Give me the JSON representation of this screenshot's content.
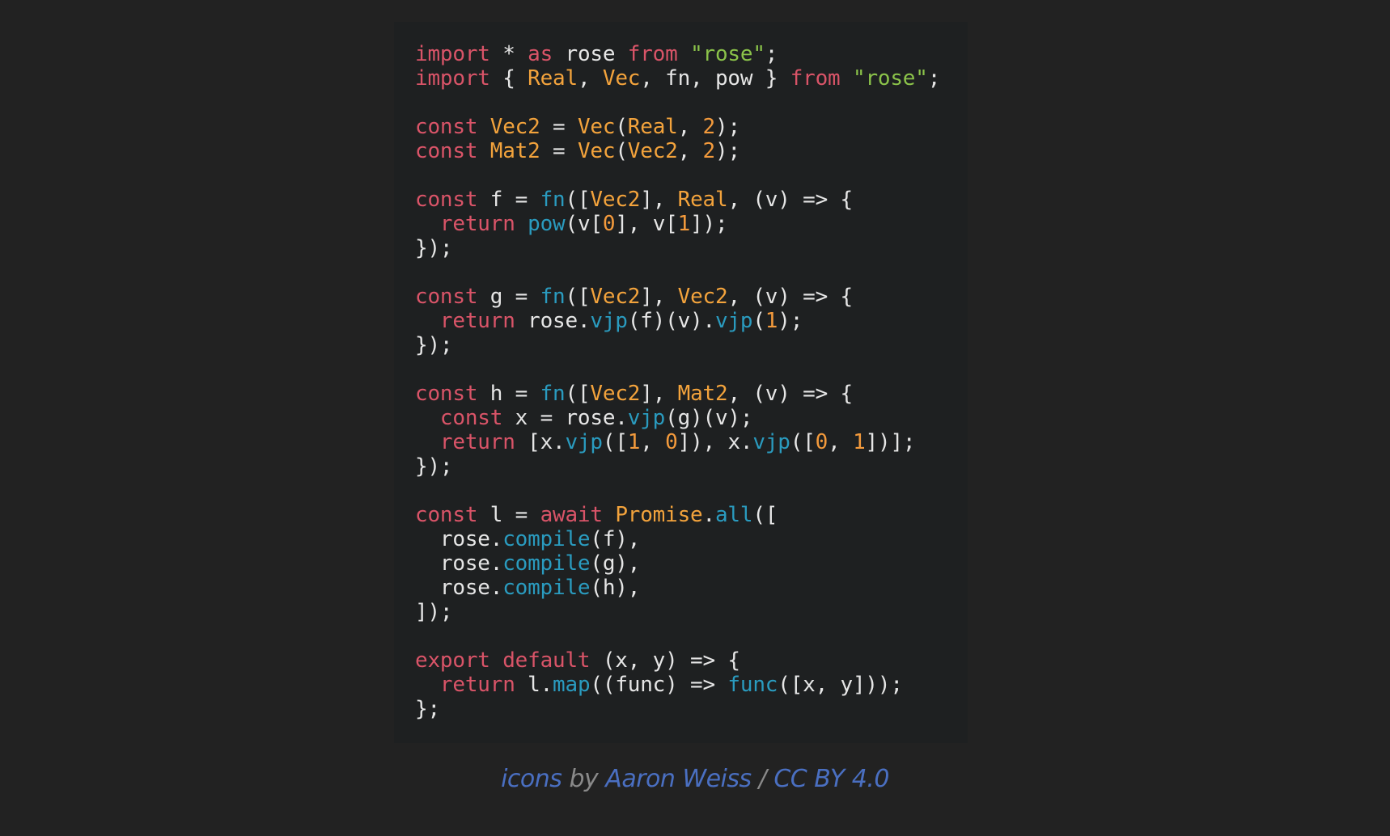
{
  "colors": {
    "background": "#222222",
    "code_background": "#1e2021",
    "keyword": "#d95468",
    "string": "#8bc34a",
    "type": "#f3a33c",
    "function": "#2a9bbf",
    "number": "#f39a3c",
    "plain": "#e6e6e6",
    "link": "#4a6fc1",
    "muted": "#8a8a8a"
  },
  "code": {
    "lines": [
      [
        [
          "kw",
          "import"
        ],
        [
          "pl",
          " * "
        ],
        [
          "kw",
          "as"
        ],
        [
          "pl",
          " rose "
        ],
        [
          "kw",
          "from"
        ],
        [
          "pl",
          " "
        ],
        [
          "str",
          "\"rose\""
        ],
        [
          "pl",
          ";"
        ]
      ],
      [
        [
          "kw",
          "import"
        ],
        [
          "pl",
          " { "
        ],
        [
          "ty",
          "Real"
        ],
        [
          "pl",
          ", "
        ],
        [
          "ty",
          "Vec"
        ],
        [
          "pl",
          ", fn, pow } "
        ],
        [
          "kw",
          "from"
        ],
        [
          "pl",
          " "
        ],
        [
          "str",
          "\"rose\""
        ],
        [
          "pl",
          ";"
        ]
      ],
      [],
      [
        [
          "kw",
          "const"
        ],
        [
          "pl",
          " "
        ],
        [
          "ty",
          "Vec2"
        ],
        [
          "pl",
          " = "
        ],
        [
          "ty",
          "Vec"
        ],
        [
          "pl",
          "("
        ],
        [
          "ty",
          "Real"
        ],
        [
          "pl",
          ", "
        ],
        [
          "num",
          "2"
        ],
        [
          "pl",
          ");"
        ]
      ],
      [
        [
          "kw",
          "const"
        ],
        [
          "pl",
          " "
        ],
        [
          "ty",
          "Mat2"
        ],
        [
          "pl",
          " = "
        ],
        [
          "ty",
          "Vec"
        ],
        [
          "pl",
          "("
        ],
        [
          "ty",
          "Vec2"
        ],
        [
          "pl",
          ", "
        ],
        [
          "num",
          "2"
        ],
        [
          "pl",
          ");"
        ]
      ],
      [],
      [
        [
          "kw",
          "const"
        ],
        [
          "pl",
          " f = "
        ],
        [
          "fn",
          "fn"
        ],
        [
          "pl",
          "(["
        ],
        [
          "ty",
          "Vec2"
        ],
        [
          "pl",
          "], "
        ],
        [
          "ty",
          "Real"
        ],
        [
          "pl",
          ", (v) => {"
        ]
      ],
      [
        [
          "pl",
          "  "
        ],
        [
          "kw",
          "return"
        ],
        [
          "pl",
          " "
        ],
        [
          "fn",
          "pow"
        ],
        [
          "pl",
          "(v["
        ],
        [
          "num",
          "0"
        ],
        [
          "pl",
          "], v["
        ],
        [
          "num",
          "1"
        ],
        [
          "pl",
          "]);"
        ]
      ],
      [
        [
          "pl",
          "});"
        ]
      ],
      [],
      [
        [
          "kw",
          "const"
        ],
        [
          "pl",
          " g = "
        ],
        [
          "fn",
          "fn"
        ],
        [
          "pl",
          "(["
        ],
        [
          "ty",
          "Vec2"
        ],
        [
          "pl",
          "], "
        ],
        [
          "ty",
          "Vec2"
        ],
        [
          "pl",
          ", (v) => {"
        ]
      ],
      [
        [
          "pl",
          "  "
        ],
        [
          "kw",
          "return"
        ],
        [
          "pl",
          " rose."
        ],
        [
          "fn",
          "vjp"
        ],
        [
          "pl",
          "(f)(v)."
        ],
        [
          "fn",
          "vjp"
        ],
        [
          "pl",
          "("
        ],
        [
          "num",
          "1"
        ],
        [
          "pl",
          ");"
        ]
      ],
      [
        [
          "pl",
          "});"
        ]
      ],
      [],
      [
        [
          "kw",
          "const"
        ],
        [
          "pl",
          " h = "
        ],
        [
          "fn",
          "fn"
        ],
        [
          "pl",
          "(["
        ],
        [
          "ty",
          "Vec2"
        ],
        [
          "pl",
          "], "
        ],
        [
          "ty",
          "Mat2"
        ],
        [
          "pl",
          ", (v) => {"
        ]
      ],
      [
        [
          "pl",
          "  "
        ],
        [
          "kw",
          "const"
        ],
        [
          "pl",
          " x = rose."
        ],
        [
          "fn",
          "vjp"
        ],
        [
          "pl",
          "(g)(v);"
        ]
      ],
      [
        [
          "pl",
          "  "
        ],
        [
          "kw",
          "return"
        ],
        [
          "pl",
          " [x."
        ],
        [
          "fn",
          "vjp"
        ],
        [
          "pl",
          "(["
        ],
        [
          "num",
          "1"
        ],
        [
          "pl",
          ", "
        ],
        [
          "num",
          "0"
        ],
        [
          "pl",
          "]), x."
        ],
        [
          "fn",
          "vjp"
        ],
        [
          "pl",
          "(["
        ],
        [
          "num",
          "0"
        ],
        [
          "pl",
          ", "
        ],
        [
          "num",
          "1"
        ],
        [
          "pl",
          "])];"
        ]
      ],
      [
        [
          "pl",
          "});"
        ]
      ],
      [],
      [
        [
          "kw",
          "const"
        ],
        [
          "pl",
          " l = "
        ],
        [
          "kw",
          "await"
        ],
        [
          "pl",
          " "
        ],
        [
          "ty",
          "Promise"
        ],
        [
          "pl",
          "."
        ],
        [
          "fn",
          "all"
        ],
        [
          "pl",
          "(["
        ]
      ],
      [
        [
          "pl",
          "  rose."
        ],
        [
          "fn",
          "compile"
        ],
        [
          "pl",
          "(f),"
        ]
      ],
      [
        [
          "pl",
          "  rose."
        ],
        [
          "fn",
          "compile"
        ],
        [
          "pl",
          "(g),"
        ]
      ],
      [
        [
          "pl",
          "  rose."
        ],
        [
          "fn",
          "compile"
        ],
        [
          "pl",
          "(h),"
        ]
      ],
      [
        [
          "pl",
          "]);"
        ]
      ],
      [],
      [
        [
          "kw",
          "export"
        ],
        [
          "pl",
          " "
        ],
        [
          "kw",
          "default"
        ],
        [
          "pl",
          " (x, y) => {"
        ]
      ],
      [
        [
          "pl",
          "  "
        ],
        [
          "kw",
          "return"
        ],
        [
          "pl",
          " l."
        ],
        [
          "fn",
          "map"
        ],
        [
          "pl",
          "((func) => "
        ],
        [
          "fn",
          "func"
        ],
        [
          "pl",
          "([x, y]));"
        ]
      ],
      [
        [
          "pl",
          "};"
        ]
      ]
    ]
  },
  "footer": {
    "icons_link": "icons",
    "by_text": " by ",
    "author_link": "Aaron Weiss",
    "separator": " / ",
    "license_link": "CC BY 4.0"
  }
}
